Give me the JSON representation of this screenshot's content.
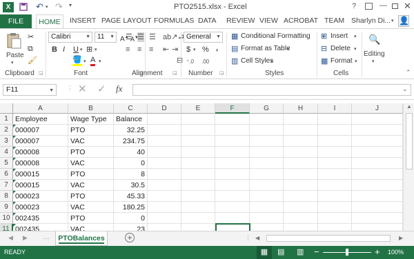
{
  "title": "PTO2515.xlsx - Excel",
  "user": "Sharlyn Di...",
  "tabs": {
    "file": "FILE",
    "items": [
      "HOME",
      "INSERT",
      "PAGE LAYOUT",
      "FORMULAS",
      "DATA",
      "REVIEW",
      "VIEW",
      "ACROBAT",
      "TEAM"
    ]
  },
  "ribbon": {
    "clipboard": {
      "label": "Clipboard",
      "paste": "Paste"
    },
    "font": {
      "label": "Font",
      "name": "Calibri",
      "size": "11",
      "bold": "B",
      "italic": "I",
      "underline": "U"
    },
    "alignment": {
      "label": "Alignment"
    },
    "number": {
      "label": "Number",
      "format": "General",
      "currency": "$",
      "percent": "%",
      "comma": ","
    },
    "styles": {
      "label": "Styles",
      "conditional": "Conditional Formatting",
      "format_table": "Format as Table",
      "cell_styles": "Cell Styles"
    },
    "cells": {
      "label": "Cells",
      "insert": "Insert",
      "delete": "Delete",
      "format": "Format"
    },
    "editing": {
      "label": "Editing"
    }
  },
  "formula_bar": {
    "name_box": "F11",
    "fx": "fx",
    "value": ""
  },
  "columns": [
    "A",
    "B",
    "C",
    "D",
    "E",
    "F",
    "G",
    "H",
    "I",
    "J"
  ],
  "rows": [
    "1",
    "2",
    "3",
    "4",
    "5",
    "6",
    "7",
    "8",
    "9",
    "10",
    "11"
  ],
  "cells": [
    [
      "Employee",
      "Wage Type",
      "Balance"
    ],
    [
      "000007",
      "PTO",
      "32.25"
    ],
    [
      "000007",
      "VAC",
      "234.75"
    ],
    [
      "000008",
      "PTO",
      "40"
    ],
    [
      "000008",
      "VAC",
      "0"
    ],
    [
      "000015",
      "PTO",
      "8"
    ],
    [
      "000015",
      "VAC",
      "30.5"
    ],
    [
      "000023",
      "PTO",
      "45.33"
    ],
    [
      "000023",
      "VAC",
      "180.25"
    ],
    [
      "002435",
      "PTO",
      "0"
    ],
    [
      "002435",
      "VAC",
      "23"
    ]
  ],
  "selected_cell": "F11",
  "sheet_tab": "PTOBalances",
  "status": {
    "ready": "READY",
    "zoom": "100%"
  },
  "colors": {
    "accent": "#217346",
    "text_indicator": "#1e7145"
  }
}
